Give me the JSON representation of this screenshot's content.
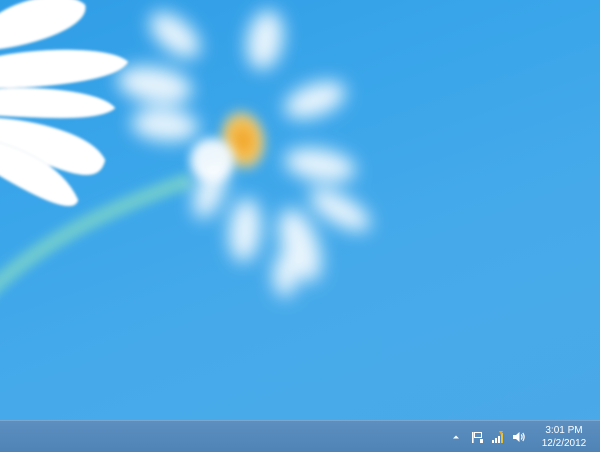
{
  "desktop": {
    "wallpaper": "blurred white daisy flower on blue background",
    "background_color": "#3ba6ea"
  },
  "taskbar": {
    "color": "#5488bb",
    "tray": {
      "icons": [
        {
          "name": "show-hidden-icons-chevron-icon",
          "glyph": "chevron-up"
        },
        {
          "name": "action-center-flag-icon",
          "glyph": "flag"
        },
        {
          "name": "network-signal-icon",
          "glyph": "signal-bars"
        },
        {
          "name": "volume-speaker-icon",
          "glyph": "speaker"
        }
      ],
      "clock": {
        "time": "3:01 PM",
        "date": "12/2/2012"
      }
    }
  }
}
